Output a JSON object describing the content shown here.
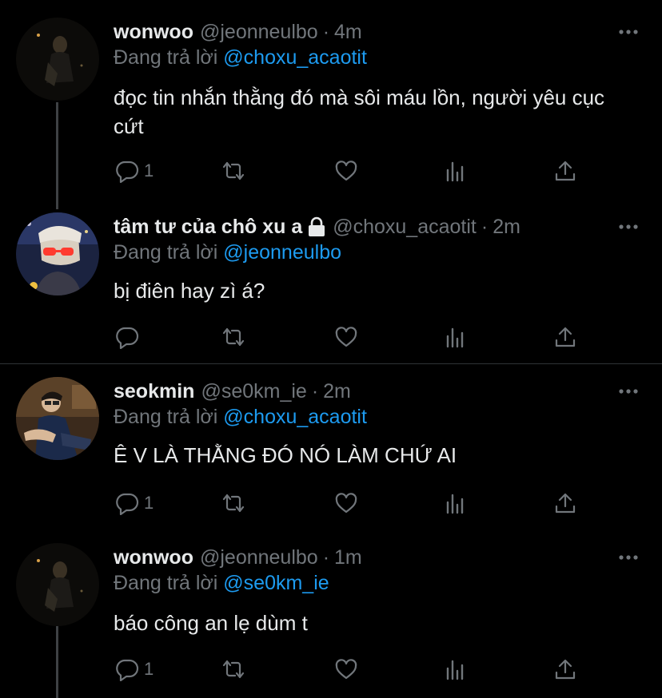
{
  "tweets": [
    {
      "name": "wonwoo",
      "handle": "@jeonneulbo",
      "dot": "·",
      "time": "4m",
      "reply_prefix": "Đang trả lời ",
      "reply_mention": "@choxu_acaotit",
      "text": "đọc tin nhắn thằng đó mà sôi máu lồn, người yêu cục cứt",
      "reply_count": "1",
      "retweet_count": "",
      "like_count": ""
    },
    {
      "name": "tâm tư của chô xu a",
      "handle": "@choxu_acaotit",
      "dot": "·",
      "time": "2m",
      "reply_prefix": "Đang trả lời ",
      "reply_mention": "@jeonneulbo",
      "text": "bị điên hay zì á?",
      "reply_count": "",
      "retweet_count": "",
      "like_count": ""
    },
    {
      "name": "seokmin",
      "handle": "@se0km_ie",
      "dot": "·",
      "time": "2m",
      "reply_prefix": "Đang trả lời ",
      "reply_mention": "@choxu_acaotit",
      "text": "Ê V LÀ THẰNG ĐÓ NÓ LÀM CHỨ AI",
      "reply_count": "1",
      "retweet_count": "",
      "like_count": ""
    },
    {
      "name": "wonwoo",
      "handle": "@jeonneulbo",
      "dot": "·",
      "time": "1m",
      "reply_prefix": "Đang trả lời ",
      "reply_mention": "@se0km_ie",
      "text": "báo công an lẹ dùm t",
      "reply_count": "1",
      "retweet_count": "",
      "like_count": ""
    }
  ],
  "colors": {
    "background": "#000000",
    "text": "#e7e9ea",
    "secondary": "#71767b",
    "accent": "#1d9bf0",
    "thread_line": "#3e4144"
  },
  "icons": [
    "reply-icon",
    "retweet-icon",
    "like-icon",
    "analytics-icon",
    "share-icon",
    "more-icon",
    "lock-icon"
  ]
}
